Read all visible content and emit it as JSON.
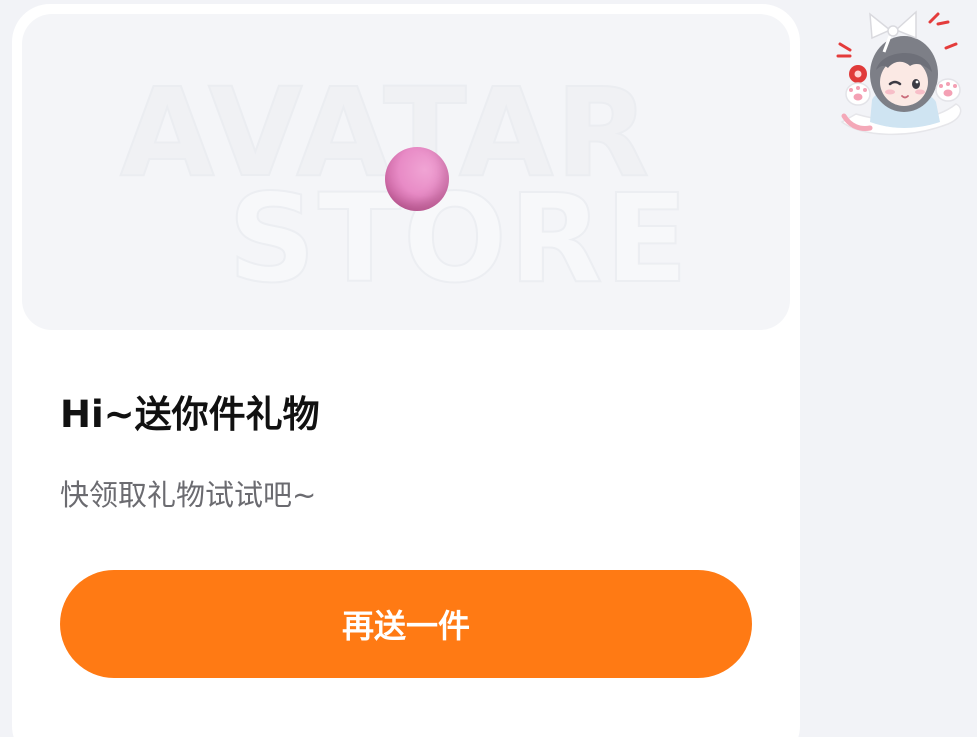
{
  "banner": {
    "watermark_line1": "AVATAR",
    "watermark_line2": "STORE"
  },
  "dialog": {
    "title": "Hi~送你件礼物",
    "subtitle": "快领取礼物试试吧~",
    "cta_label": "再送一件"
  },
  "colors": {
    "page_background": "#f2f3f7",
    "card_background": "#ffffff",
    "banner_background": "#f4f5f8",
    "accent_orange": "#ff7a14",
    "gift_ball_pink": "#e88bc6"
  },
  "icons": {
    "gift_ball": "pink-ball-icon",
    "avatar": "anime-girl-bow-avatar"
  }
}
